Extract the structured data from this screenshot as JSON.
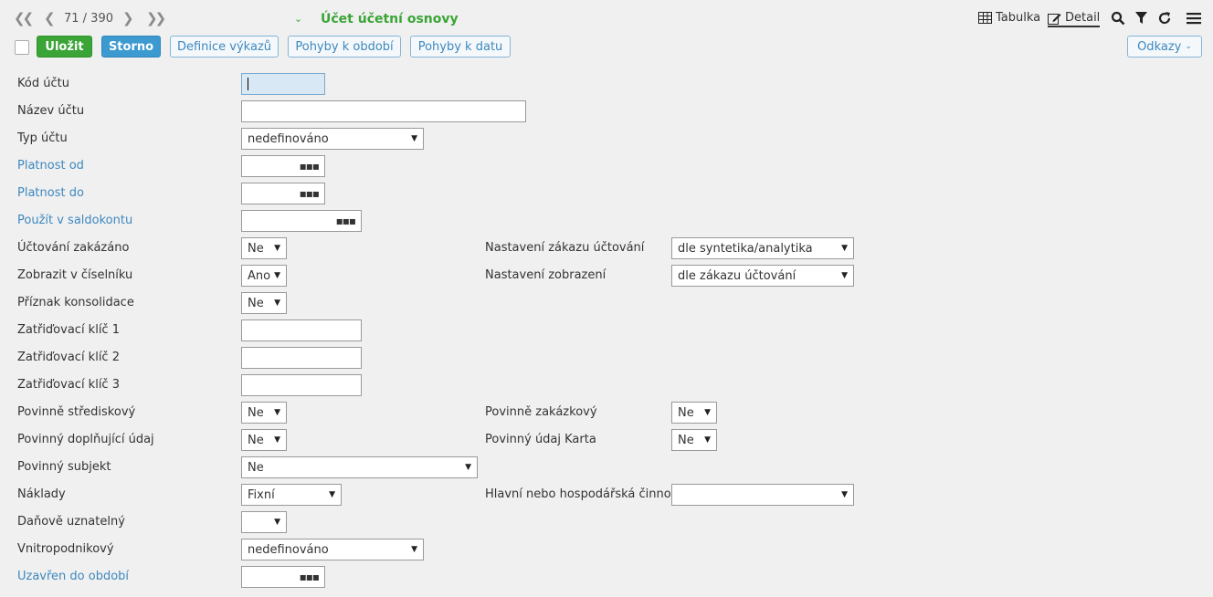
{
  "nav": {
    "counter": "71 / 390"
  },
  "header": {
    "title": "Účet účetní osnovy"
  },
  "views": {
    "table": "Tabulka",
    "detail": "Detail"
  },
  "toolbar": {
    "save": "Uložit",
    "cancel": "Storno",
    "report_def": "Definice výkazů",
    "moves_period": "Pohyby k období",
    "moves_date": "Pohyby k datu",
    "links": "Odkazy"
  },
  "form": {
    "kod_uctu": {
      "label": "Kód účtu",
      "value": ""
    },
    "nazev_uctu": {
      "label": "Název účtu",
      "value": ""
    },
    "typ_uctu": {
      "label": "Typ účtu",
      "value": "nedefinováno"
    },
    "platnost_od": {
      "label": "Platnost od",
      "value": ""
    },
    "platnost_do": {
      "label": "Platnost do",
      "value": ""
    },
    "saldokonto": {
      "label": "Použít v saldokontu",
      "value": ""
    },
    "uctovani_zakazano": {
      "label": "Účtování zakázáno",
      "value": "Ne"
    },
    "zobrazit_ciselnik": {
      "label": "Zobrazit v číselníku",
      "value": "Ano"
    },
    "priznak_konsolidace": {
      "label": "Příznak konsolidace",
      "value": "Ne"
    },
    "klic1": {
      "label": "Zatřiďovací klíč 1",
      "value": ""
    },
    "klic2": {
      "label": "Zatřiďovací klíč 2",
      "value": ""
    },
    "klic3": {
      "label": "Zatřiďovací klíč 3",
      "value": ""
    },
    "povinne_strediskovy": {
      "label": "Povinně střediskový",
      "value": "Ne"
    },
    "povinny_doplnujici": {
      "label": "Povinný doplňující údaj",
      "value": "Ne"
    },
    "povinny_subjekt": {
      "label": "Povinný subjekt",
      "value": "Ne"
    },
    "naklady": {
      "label": "Náklady",
      "value": "Fixní"
    },
    "danove_uznatelny": {
      "label": "Daňově uznatelný",
      "value": ""
    },
    "vnitropodnikovy": {
      "label": "Vnitropodnikový",
      "value": "nedefinováno"
    },
    "uzavren_do": {
      "label": "Uzavřen do období",
      "value": ""
    },
    "nastaveni_zakazu": {
      "label": "Nastavení zákazu účtování",
      "value": "dle syntetika/analytika"
    },
    "nastaveni_zobrazeni": {
      "label": "Nastavení zobrazení",
      "value": "dle zákazu účtování"
    },
    "povinne_zakazkovy": {
      "label": "Povinně zakázkový",
      "value": "Ne"
    },
    "povinny_karta": {
      "label": "Povinný údaj Karta",
      "value": "Ne"
    },
    "hlavni_cinnost": {
      "label": "Hlavní nebo hospodářská činnost",
      "value": ""
    }
  }
}
